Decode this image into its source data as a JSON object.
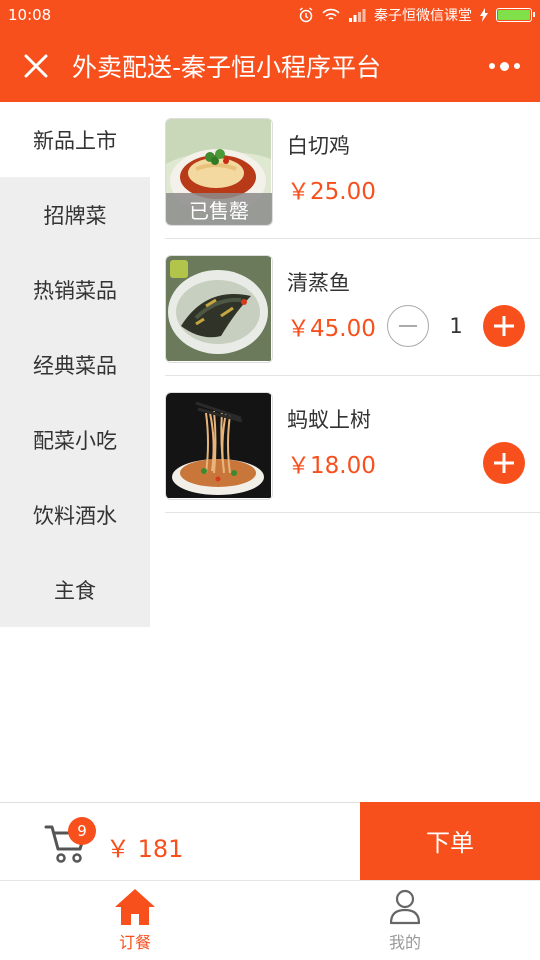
{
  "status": {
    "time": "10:08",
    "carrier": "秦子恒微信课堂"
  },
  "nav": {
    "title": "外卖配送-秦子恒小程序平台"
  },
  "sidebar": {
    "items": [
      {
        "label": "新品上市"
      },
      {
        "label": "招牌菜"
      },
      {
        "label": "热销菜品"
      },
      {
        "label": "经典菜品"
      },
      {
        "label": "配菜小吃"
      },
      {
        "label": "饮料酒水"
      },
      {
        "label": "主食"
      }
    ],
    "active_index": 0
  },
  "dishes": [
    {
      "name": "白切鸡",
      "price": "￥25.00",
      "soldout_label": "已售罄"
    },
    {
      "name": "清蒸鱼",
      "price": "￥45.00",
      "quantity": "1"
    },
    {
      "name": "蚂蚁上树",
      "price": "￥18.00"
    }
  ],
  "cart": {
    "count": "9",
    "total": "￥ 181",
    "order_label": "下单"
  },
  "tabs": [
    {
      "label": "订餐",
      "icon": "home-icon",
      "active": true
    },
    {
      "label": "我的",
      "icon": "user-icon",
      "active": false
    }
  ],
  "colors": {
    "accent": "#f8501d",
    "sidebar_bg": "#eeeeee",
    "battery": "#7fe04a"
  }
}
